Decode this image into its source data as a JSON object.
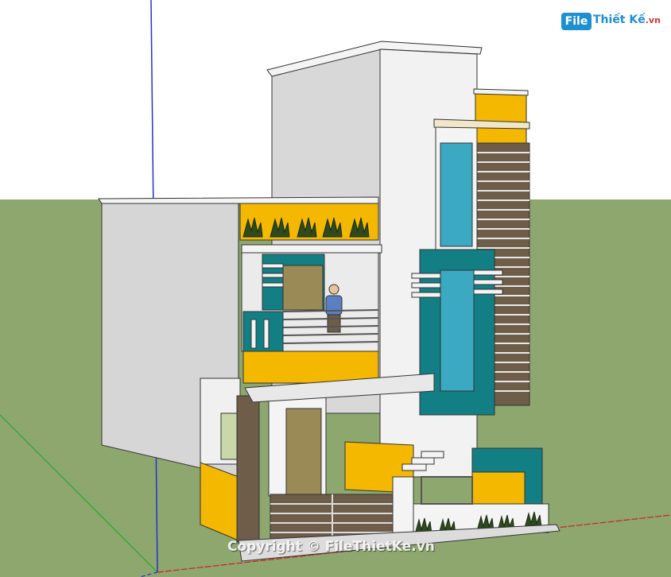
{
  "scene": {
    "subject": "3D SketchUp model of a two-storey townhouse facade",
    "colors": {
      "sky": "#ffffff",
      "grass": "#8ea76f",
      "wall_white": "#f2f2f2",
      "wall_grey": "#d9d9d9",
      "accent_yellow": "#f5b800",
      "accent_teal": "#127f84",
      "window_blue": "#3ba9c1",
      "wood_brown": "#6d5d49",
      "door_olive": "#9a8a55",
      "axis_blue": "#2233cc",
      "axis_red": "#cc2222",
      "axis_green": "#22aa22"
    }
  },
  "watermark": {
    "logo_badge": "File",
    "logo_name": "Thiết Kế",
    "logo_suffix": ".vn",
    "copyright": "Copyright © FileThietKe.vn"
  }
}
